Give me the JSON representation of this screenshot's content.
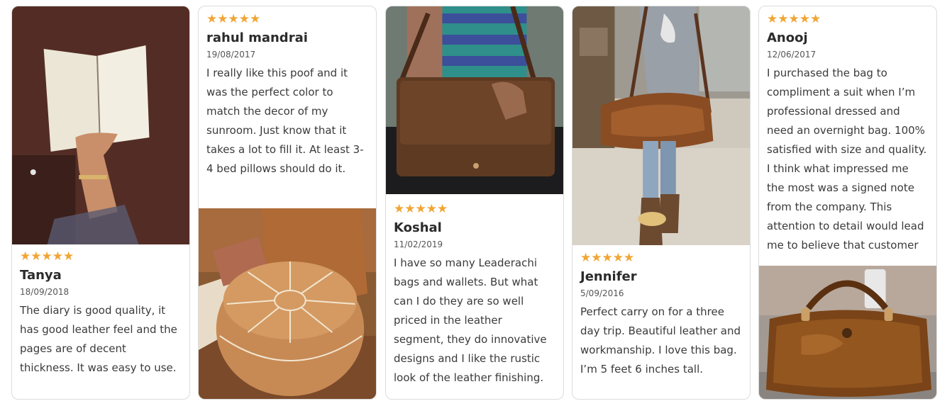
{
  "colors": {
    "star": "#f1a534",
    "border": "#dcdcdc"
  },
  "rating_glyphs": "★★★★★",
  "reviews": [
    {
      "stars": "★★★★★",
      "name": "Tanya",
      "date": "18/09/2018",
      "text": "The diary is good quality, it has good leather feel and the pages are of decent thickness. It was easy to use.",
      "photo": "leather-journal-photo"
    },
    {
      "stars": "★★★★★",
      "name": "rahul mandrai",
      "date": "19/08/2017",
      "text": "I really like this poof and it was the perfect color to match the decor of my sunroom. Just know that it takes a lot to fill it. At least 3-4 bed pillows should do it.",
      "photo": "leather-pouf-photo"
    },
    {
      "stars": "★★★★★",
      "name": "Koshal",
      "date": "11/02/2019",
      "text": "I have so many Leaderachi bags and wallets. But what can I do they are so well priced in the leather segment, they do innovative designs and I like the rustic look of the leather finishing.",
      "photo": "messenger-bag-photo"
    },
    {
      "stars": "★★★★★",
      "name": "Jennifer",
      "date": "5/09/2016",
      "text": "Perfect carry on for a three day trip. Beautiful leather and workmanship. I love this bag. I’m 5 feet 6 inches tall.",
      "photo": "duffel-bag-worn-photo"
    },
    {
      "stars": "★★★★★",
      "name": "Anooj",
      "date": "12/06/2017",
      "text": "I purchased the bag to compliment a suit when I’m professional dressed and need an overnight bag. 100% satisfied with size and quality. I think what impressed me the most was a signed note from the company. This attention to detail would lead me to believe that customer",
      "photo": "duffel-bag-photo"
    }
  ]
}
